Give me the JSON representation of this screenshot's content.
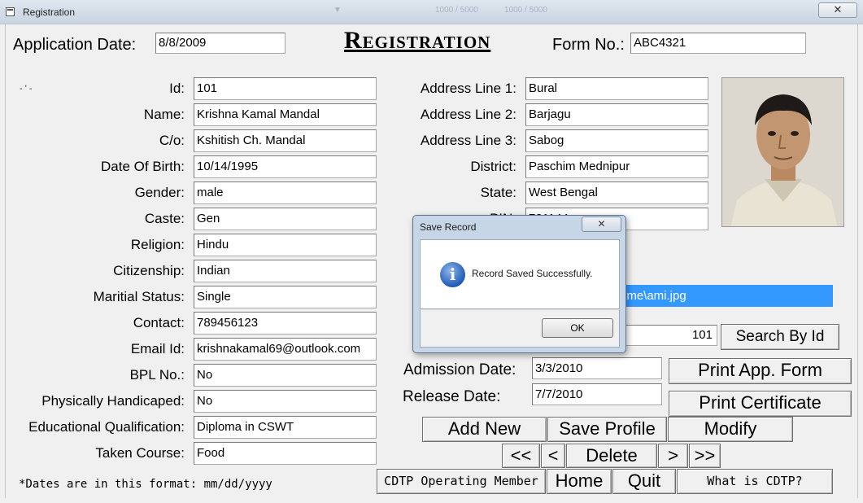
{
  "window": {
    "title": "Registration",
    "close_glyph": "✕",
    "bg_text": [
      "1000 / 5000",
      "▼",
      "1000 / 5000"
    ]
  },
  "header": {
    "app_date_label": "Application Date:",
    "app_date_value": "8/8/2009",
    "heading": "Registration",
    "form_no_label": "Form No.:",
    "form_no_value": "ABC4321",
    "stray_mark": "- ' -"
  },
  "left_fields": [
    {
      "label": "Id:",
      "value": "101"
    },
    {
      "label": "Name:",
      "value": "Krishna Kamal Mandal"
    },
    {
      "label": "C/o:",
      "value": "Kshitish Ch. Mandal"
    },
    {
      "label": "Date Of Birth:",
      "value": "10/14/1995"
    },
    {
      "label": "Gender:",
      "value": "male"
    },
    {
      "label": "Caste:",
      "value": "Gen"
    },
    {
      "label": "Religion:",
      "value": "Hindu"
    },
    {
      "label": "Citizenship:",
      "value": "Indian"
    },
    {
      "label": "Maritial Status:",
      "value": "Single"
    },
    {
      "label": "Contact:",
      "value": "789456123"
    },
    {
      "label": "Email Id:",
      "value": "krishnakamal69@outlook.com"
    },
    {
      "label": "BPL No.:",
      "value": "No"
    },
    {
      "label": "Physically Handicaped:",
      "value": "No"
    },
    {
      "label": "Educational Qualification:",
      "value": "Diploma in CSWT"
    },
    {
      "label": "Taken Course:",
      "value": "Food"
    }
  ],
  "right_fields": [
    {
      "label": "Address Line 1:",
      "value": "Bural"
    },
    {
      "label": "Address Line 2:",
      "value": "Barjagu"
    },
    {
      "label": "Address Line 3:",
      "value": "Sabog"
    },
    {
      "label": "District:",
      "value": "Paschim Mednipur"
    },
    {
      "label": "State:",
      "value": "West Bengal"
    },
    {
      "label": "PIN:",
      "value": "721144"
    }
  ],
  "photo_path": ":\\me\\ami.jpg",
  "search": {
    "value": "101",
    "button": "Search By Id"
  },
  "dates": {
    "admission_label": "Admission Date:",
    "admission_value": "3/3/2010",
    "release_label": "Release Date:",
    "release_value": "7/7/2010"
  },
  "buttons": {
    "print_app_form": "Print App. Form",
    "print_certificate": "Print Certificate",
    "add_new": "Add New",
    "save_profile": "Save Profile",
    "modify": "Modify",
    "first": "<<",
    "prev": "<",
    "delete": "Delete",
    "next": ">",
    "last": ">>",
    "cdtp_member": "CDTP Operating Member",
    "home": "Home",
    "quit": "Quit",
    "what_is_cdtp": "What is CDTP?"
  },
  "note": "*Dates are in this format: mm/dd/yyyy",
  "dialog": {
    "title": "Save Record",
    "message": "Record Saved Successfully.",
    "ok": "OK",
    "close_glyph": "✕",
    "icon_glyph": "i"
  },
  "colors": {
    "selection": "#3399ff",
    "dialog_frame": "#c7d6e6",
    "info_icon": "#1f5bb8"
  }
}
